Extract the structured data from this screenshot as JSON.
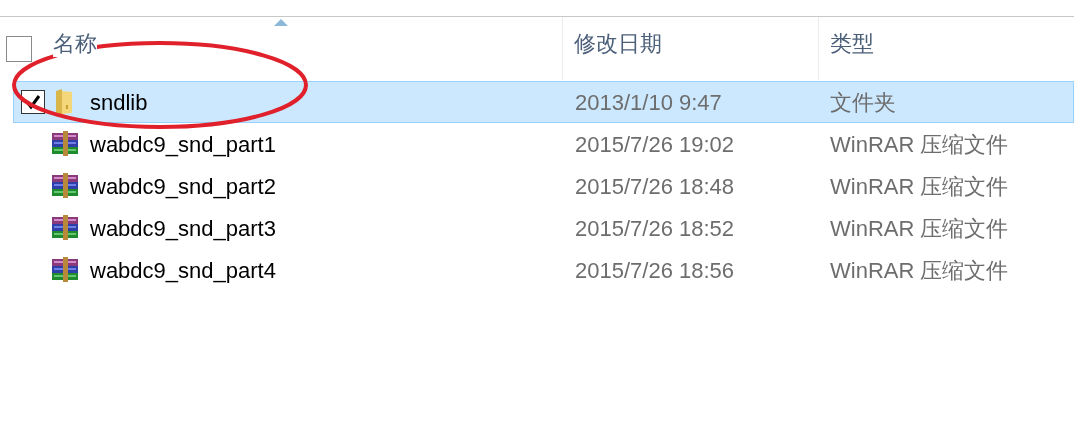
{
  "header": {
    "select_all_checked": false,
    "columns": [
      {
        "label": "名称",
        "sorted": true
      },
      {
        "label": "修改日期",
        "sorted": false
      },
      {
        "label": "类型",
        "sorted": false
      }
    ]
  },
  "rows": [
    {
      "kind": "folder",
      "name": "sndlib",
      "modified": "2013/1/10 9:47",
      "type": "文件夹",
      "selected": true,
      "checked": true
    },
    {
      "kind": "archive",
      "name": "wabdc9_snd_part1",
      "modified": "2015/7/26 19:02",
      "type": "WinRAR 压缩文件",
      "selected": false,
      "checked": false
    },
    {
      "kind": "archive",
      "name": "wabdc9_snd_part2",
      "modified": "2015/7/26 18:48",
      "type": "WinRAR 压缩文件",
      "selected": false,
      "checked": false
    },
    {
      "kind": "archive",
      "name": "wabdc9_snd_part3",
      "modified": "2015/7/26 18:52",
      "type": "WinRAR 压缩文件",
      "selected": false,
      "checked": false
    },
    {
      "kind": "archive",
      "name": "wabdc9_snd_part4",
      "modified": "2015/7/26 18:56",
      "type": "WinRAR 压缩文件",
      "selected": false,
      "checked": false
    }
  ],
  "annotation": {
    "kind": "ellipse",
    "color": "#e0202a"
  }
}
